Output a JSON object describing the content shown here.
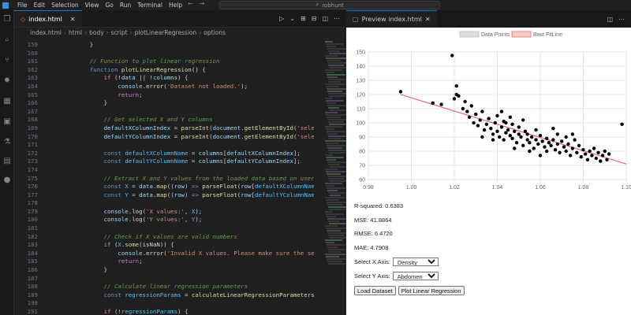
{
  "titlebar": {
    "menu": [
      "File",
      "Edit",
      "Selection",
      "View",
      "Go",
      "Run",
      "Terminal",
      "Help"
    ],
    "search_text": "robhunt"
  },
  "editor": {
    "tab_title": "index.html",
    "breadcrumb": [
      "index.html",
      "html",
      "body",
      "script",
      "plotLinearRegression",
      "options"
    ],
    "lines": [
      {
        "n": "159",
        "html": "<span class=\"txt\">    }</span>"
      },
      {
        "n": "160",
        "html": "<span class=\"txt\"> </span>"
      },
      {
        "n": "161",
        "html": "<span class=\"txt\">    <span class=\"cm\">// Function to plot linear regression</span></span>"
      },
      {
        "n": "162",
        "html": "<span class=\"txt\">    <span class=\"kw2\">function</span> <span class=\"fn\">plotLinearRegression</span>() {</span>"
      },
      {
        "n": "163",
        "html": "<span class=\"txt\">        <span class=\"kw\">if</span> (!<span class=\"var\">data</span> || !<span class=\"var\">columns</span>) {</span>"
      },
      {
        "n": "164",
        "html": "<span class=\"txt\">            <span class=\"var\">console</span>.<span class=\"fn\">error</span>(<span class=\"str\">'Dataset not loaded.'</span>);</span>"
      },
      {
        "n": "165",
        "html": "<span class=\"txt\">            <span class=\"kw\">return</span>;</span>"
      },
      {
        "n": "166",
        "html": "<span class=\"txt\">        }</span>"
      },
      {
        "n": "167",
        "html": "<span class=\"txt\"> </span>"
      },
      {
        "n": "168",
        "html": "<span class=\"txt\">        <span class=\"cm\">// Get selected X and Y columns</span></span>"
      },
      {
        "n": "169",
        "html": "<span class=\"txt\">        <span class=\"var\">defaultXColumnIndex</span> = <span class=\"fn\">parseInt</span>(<span class=\"var\">document</span>.<span class=\"fn\">getElementById</span>(<span class=\"str\">'selectX'</span>)</span>"
      },
      {
        "n": "170",
        "html": "<span class=\"txt\">        <span class=\"var\">defaultYColumnIndex</span> = <span class=\"fn\">parseInt</span>(<span class=\"var\">document</span>.<span class=\"fn\">getElementById</span>(<span class=\"str\">'selectY'</span>)</span>"
      },
      {
        "n": "171",
        "html": "<span class=\"txt\"> </span>"
      },
      {
        "n": "172",
        "html": "<span class=\"txt\">        <span class=\"kw2\">const</span> <span class=\"cst\">defaultXColumnName</span> = <span class=\"var\">columns</span>[<span class=\"var\">defaultXColumnIndex</span>];</span>"
      },
      {
        "n": "173",
        "html": "<span class=\"txt\">        <span class=\"kw2\">const</span> <span class=\"cst\">defaultYColumnName</span> = <span class=\"var\">columns</span>[<span class=\"var\">defaultYColumnIndex</span>];</span>"
      },
      {
        "n": "174",
        "html": "<span class=\"txt\"> </span>"
      },
      {
        "n": "175",
        "html": "<span class=\"txt\">        <span class=\"cm\">// Extract X and Y values from the loaded data based on user sele</span></span>"
      },
      {
        "n": "176",
        "html": "<span class=\"txt\">        <span class=\"kw2\">const</span> <span class=\"cst\">X</span> = <span class=\"var\">data</span>.<span class=\"fn\">map</span>((<span class=\"var\">row</span>) <span class=\"kw2\">=&gt;</span> <span class=\"fn\">parseFloat</span>(<span class=\"var\">row</span>[<span class=\"cst\">defaultXColumnName</span>]));</span>"
      },
      {
        "n": "177",
        "html": "<span class=\"txt\">        <span class=\"kw2\">const</span> <span class=\"cst\">Y</span> = <span class=\"var\">data</span>.<span class=\"fn\">map</span>((<span class=\"var\">row</span>) <span class=\"kw2\">=&gt;</span> <span class=\"fn\">parseFloat</span>(<span class=\"var\">row</span>[<span class=\"cst\">defaultYColumnName</span>]));</span>"
      },
      {
        "n": "178",
        "html": "<span class=\"txt\"> </span>"
      },
      {
        "n": "179",
        "html": "<span class=\"txt\">        <span class=\"var\">console</span>.<span class=\"fn\">log</span>(<span class=\"str\">'X values:'</span>, <span class=\"cst\">X</span>);</span>"
      },
      {
        "n": "180",
        "html": "<span class=\"txt\">        <span class=\"var\">console</span>.<span class=\"fn\">log</span>(<span class=\"str\">'Y values:'</span>, <span class=\"cst\">Y</span>);</span>"
      },
      {
        "n": "181",
        "html": "<span class=\"txt\"> </span>"
      },
      {
        "n": "182",
        "html": "<span class=\"txt\">        <span class=\"cm\">// Check if X values are valid numbers</span></span>"
      },
      {
        "n": "183",
        "html": "<span class=\"txt\">        <span class=\"kw\">if</span> (<span class=\"cst\">X</span>.<span class=\"fn\">some</span>(<span class=\"fn\">isNaN</span>)) {</span>"
      },
      {
        "n": "184",
        "html": "<span class=\"txt\">            <span class=\"var\">console</span>.<span class=\"fn\">error</span>(<span class=\"str\">'Invalid X values. Please make sure the selecte</span></span>"
      },
      {
        "n": "185",
        "html": "<span class=\"txt\">            <span class=\"kw\">return</span>;</span>"
      },
      {
        "n": "186",
        "html": "<span class=\"txt\">        }</span>"
      },
      {
        "n": "187",
        "html": "<span class=\"txt\"> </span>"
      },
      {
        "n": "188",
        "html": "<span class=\"txt\">        <span class=\"cm\">// Calculate linear regression parameters</span></span>"
      },
      {
        "n": "189",
        "html": "<span class=\"txt\">        <span class=\"kw2\">const</span> <span class=\"cst\">regressionParams</span> = <span class=\"fn\">calculateLinearRegressionParameters</span>(<span class=\"cst\">X</span>, <span class=\"cst\">Y</span></span>"
      },
      {
        "n": "190",
        "html": "<span class=\"txt\"> </span>"
      },
      {
        "n": "191",
        "html": "<span class=\"txt\">        <span class=\"kw\">if</span> (!<span class=\"cst\">regressionParams</span>) {</span>"
      }
    ]
  },
  "preview": {
    "tab_title": "Preview index.html",
    "stats": {
      "r_squared": "R-squared: 0.6383",
      "mse": "MSE: 41.8864",
      "rmse": "RMSE: 6.4720",
      "mae": "MAE: 4.7908"
    },
    "select_x_label": "Select X Axis:",
    "select_x_value": "Density",
    "select_y_label": "Select Y Axis:",
    "select_y_value": "Abdomen",
    "load_button": "Load Dataset",
    "plot_button": "Plot Linear Regression"
  },
  "chart_data": {
    "type": "scatter",
    "legend": [
      "Data Points",
      "Best FitLine"
    ],
    "legend_placement": "top",
    "xlim": [
      0.98,
      1.1
    ],
    "ylim": [
      60,
      150
    ],
    "x_ticks": [
      "0.98",
      "1.00",
      "1.02",
      "1.04",
      "1.06",
      "1.08",
      "1.10"
    ],
    "y_ticks": [
      "60",
      "70",
      "80",
      "90",
      "100",
      "110",
      "120",
      "130",
      "140",
      "150"
    ],
    "grid": true,
    "colors": {
      "points": "#000000",
      "line": "#e86c6c",
      "line_legend_fill": "#f6cccc",
      "points_legend_fill": "#dcdcdc"
    },
    "line": {
      "x": [
        0.995,
        1.1
      ],
      "y": [
        120,
        71
      ]
    },
    "points": [
      [
        0.995,
        122
      ],
      [
        1.01,
        114
      ],
      [
        1.014,
        113
      ],
      [
        1.019,
        147.5
      ],
      [
        1.02,
        117
      ],
      [
        1.021,
        120
      ],
      [
        1.021,
        126
      ],
      [
        1.022,
        119
      ],
      [
        1.024,
        110
      ],
      [
        1.025,
        115
      ],
      [
        1.026,
        108
      ],
      [
        1.027,
        104
      ],
      [
        1.028,
        112
      ],
      [
        1.029,
        100
      ],
      [
        1.03,
        106
      ],
      [
        1.031,
        98
      ],
      [
        1.032,
        102
      ],
      [
        1.033,
        108
      ],
      [
        1.034,
        95
      ],
      [
        1.035,
        99
      ],
      [
        1.036,
        103
      ],
      [
        1.037,
        96
      ],
      [
        1.038,
        92
      ],
      [
        1.039,
        100
      ],
      [
        1.04,
        105
      ],
      [
        1.04,
        94
      ],
      [
        1.041,
        90
      ],
      [
        1.042,
        97
      ],
      [
        1.043,
        101
      ],
      [
        1.043,
        88
      ],
      [
        1.044,
        93
      ],
      [
        1.045,
        95
      ],
      [
        1.046,
        91
      ],
      [
        1.047,
        89
      ],
      [
        1.047,
        99
      ],
      [
        1.048,
        94
      ],
      [
        1.049,
        86
      ],
      [
        1.05,
        92
      ],
      [
        1.05,
        97
      ],
      [
        1.051,
        90
      ],
      [
        1.052,
        84
      ],
      [
        1.053,
        94
      ],
      [
        1.054,
        88
      ],
      [
        1.054,
        92
      ],
      [
        1.055,
        86
      ],
      [
        1.056,
        90
      ],
      [
        1.057,
        82
      ],
      [
        1.058,
        88
      ],
      [
        1.058,
        95
      ],
      [
        1.059,
        85
      ],
      [
        1.06,
        91
      ],
      [
        1.061,
        87
      ],
      [
        1.062,
        83
      ],
      [
        1.063,
        89
      ],
      [
        1.063,
        80
      ],
      [
        1.064,
        86
      ],
      [
        1.065,
        84
      ],
      [
        1.066,
        88
      ],
      [
        1.067,
        81
      ],
      [
        1.068,
        85
      ],
      [
        1.069,
        79
      ],
      [
        1.07,
        87
      ],
      [
        1.071,
        83
      ],
      [
        1.072,
        80
      ],
      [
        1.073,
        85
      ],
      [
        1.074,
        77
      ],
      [
        1.075,
        82
      ],
      [
        1.076,
        88
      ],
      [
        1.077,
        79
      ],
      [
        1.078,
        84
      ],
      [
        1.079,
        76
      ],
      [
        1.08,
        81
      ],
      [
        1.081,
        78
      ],
      [
        1.082,
        74
      ],
      [
        1.083,
        80
      ],
      [
        1.084,
        77
      ],
      [
        1.085,
        82
      ],
      [
        1.086,
        75
      ],
      [
        1.087,
        79
      ],
      [
        1.088,
        73
      ],
      [
        1.089,
        77
      ],
      [
        1.09,
        80
      ],
      [
        1.091,
        74
      ],
      [
        1.092,
        78
      ],
      [
        1.098,
        99
      ],
      [
        1.06,
        77
      ],
      [
        1.055,
        80
      ],
      [
        1.048,
        82
      ],
      [
        1.038,
        88
      ],
      [
        1.044,
        100
      ],
      [
        1.033,
        90
      ],
      [
        1.068,
        92
      ],
      [
        1.072,
        90
      ],
      [
        1.075,
        92
      ],
      [
        1.066,
        96
      ],
      [
        1.052,
        102
      ],
      [
        1.042,
        108
      ],
      [
        1.046,
        104
      ]
    ]
  }
}
